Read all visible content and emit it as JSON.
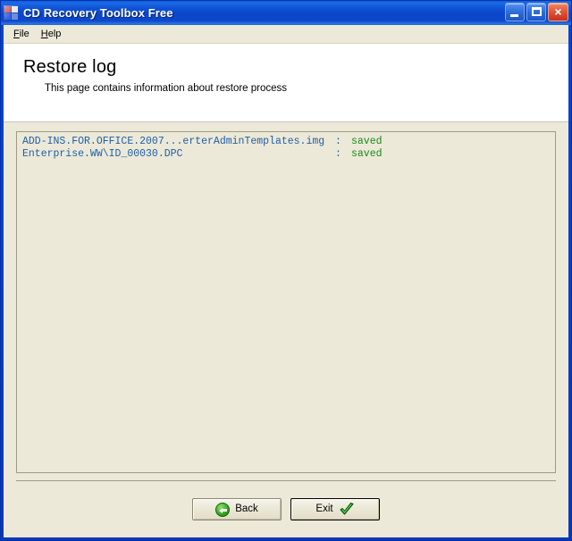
{
  "window": {
    "title": "CD Recovery Toolbox Free",
    "icon": "app-logo-icon",
    "controls": {
      "minimize": "minimize-button",
      "maximize": "maximize-button",
      "close": "×"
    }
  },
  "menubar": {
    "items": [
      {
        "label": "File",
        "mnemonic": "F"
      },
      {
        "label": "Help",
        "mnemonic": "H"
      }
    ]
  },
  "header": {
    "title": "Restore log",
    "subtitle": "This page contains information about restore process"
  },
  "log": {
    "entries": [
      {
        "name": "ADD-INS.FOR.OFFICE.2007...erterAdminTemplates.img",
        "separator": ":",
        "status": "saved"
      },
      {
        "name": "Enterprise.WW\\ID_00030.DPC",
        "separator": ":",
        "status": "saved"
      }
    ]
  },
  "footer": {
    "back_label": "Back",
    "exit_label": "Exit"
  },
  "colors": {
    "titlebar_blue": "#0b45c8",
    "client_beige": "#ece9d8",
    "log_name_blue": "#1f5fa8",
    "log_status_green": "#188a18",
    "button_green": "#3aaa22",
    "close_red": "#c8301b"
  }
}
